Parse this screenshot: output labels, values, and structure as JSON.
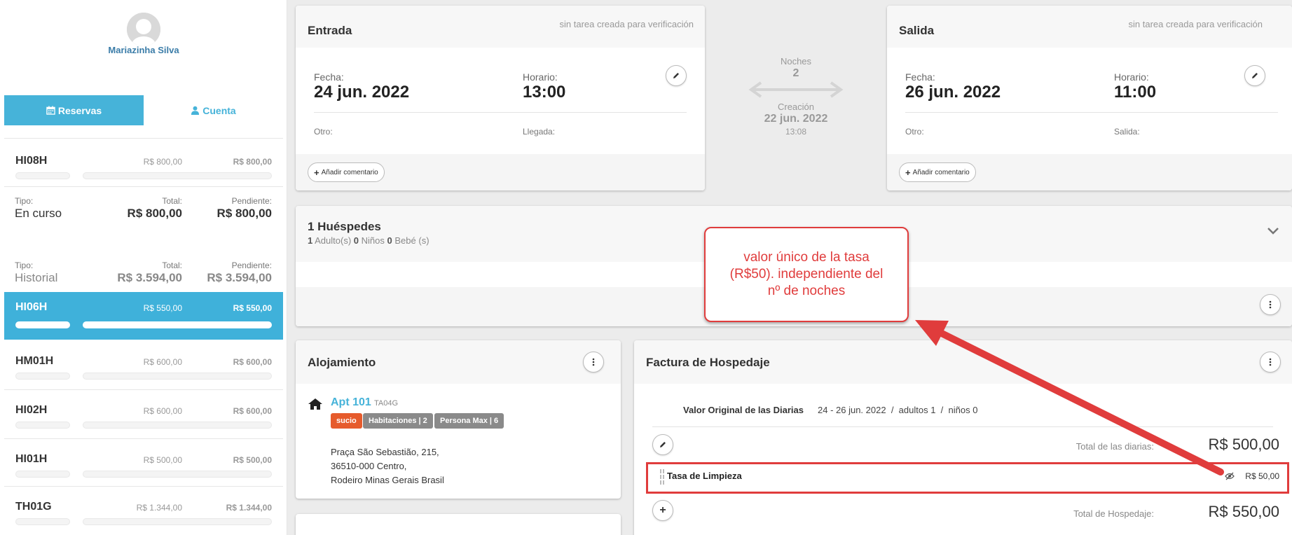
{
  "user": {
    "name": "Mariazinha Silva"
  },
  "tabs": {
    "reservas": "Reservas",
    "cuenta": "Cuenta"
  },
  "reservations": [
    {
      "code": "HI08H",
      "total": "R$ 800,00",
      "pending": "R$ 800,00"
    },
    {
      "code": "HI06H",
      "total": "R$ 550,00",
      "pending": "R$ 550,00"
    },
    {
      "code": "HM01H",
      "total": "R$ 600,00",
      "pending": "R$ 600,00"
    },
    {
      "code": "HI02H",
      "total": "R$ 600,00",
      "pending": "R$ 600,00"
    },
    {
      "code": "HI01H",
      "total": "R$ 500,00",
      "pending": "R$ 500,00"
    },
    {
      "code": "TH01G",
      "total": "R$ 1.344,00",
      "pending": "R$ 1.344,00"
    }
  ],
  "summary": {
    "current": {
      "tipo_label": "Tipo:",
      "tipo": "En curso",
      "total_label": "Total:",
      "total": "R$ 800,00",
      "pending_label": "Pendiente:",
      "pending": "R$ 800,00"
    },
    "history": {
      "tipo_label": "Tipo:",
      "tipo": "Historial",
      "total_label": "Total:",
      "total": "R$ 3.594,00",
      "pending_label": "Pendiente:",
      "pending": "R$ 3.594,00"
    }
  },
  "entrada": {
    "title": "Entrada",
    "verification": "sin tarea creada para verificación",
    "fecha_label": "Fecha:",
    "fecha": "24 jun. 2022",
    "horario_label": "Horario:",
    "horario": "13:00",
    "otro_label": "Otro:",
    "extra_label": "Llegada:",
    "comment": "Añadir comentario"
  },
  "salida": {
    "title": "Salida",
    "verification": "sin tarea creada para verificación",
    "fecha_label": "Fecha:",
    "fecha": "26 jun. 2022",
    "horario_label": "Horario:",
    "horario": "11:00",
    "otro_label": "Otro:",
    "extra_label": "Salida:",
    "comment": "Añadir comentario"
  },
  "stay": {
    "noches_label": "Noches",
    "noches": "2",
    "creacion_label": "Creación",
    "creacion_date": "22 jun. 2022",
    "creacion_time": "13:08"
  },
  "guests": {
    "title": "1 Huéspedes",
    "adults": "1",
    "adults_label": "Adulto(s)",
    "kids": "0",
    "kids_label": "Niños",
    "babies": "0",
    "babies_label": "Bebé (s)"
  },
  "alojamiento": {
    "title": "Alojamiento",
    "apt": "Apt 101",
    "apt_code": "TA04G",
    "tags": [
      "sucio",
      "Habitaciones | 2",
      "Persona Max | 6"
    ],
    "address": [
      "Praça São Sebastião, 215,",
      "36510-000 Centro,",
      "Rodeiro Minas Gerais Brasil"
    ]
  },
  "factura": {
    "title": "Factura de Hospedaje",
    "original_label": "Valor Original de las Diarias",
    "original_range": "24 - 26 jun. 2022",
    "adults_text": "adultos 1",
    "kids_text": "niños 0",
    "total_diarias_label": "Total de las diarias:",
    "total_diarias": "R$ 500,00",
    "tasa_label": "Tasa de Limpieza",
    "tasa_value": "R$ 50,00",
    "total_label": "Total de Hospedaje:",
    "total": "R$ 550,00"
  },
  "annotation": {
    "text": "valor único de la tasa (R$50). independiente del nº de noches"
  },
  "colors": {
    "accent": "#46b3d9",
    "annotation": "#e03c3c",
    "dirty": "#e65b2c",
    "tag_gray": "#8a8a8a"
  }
}
